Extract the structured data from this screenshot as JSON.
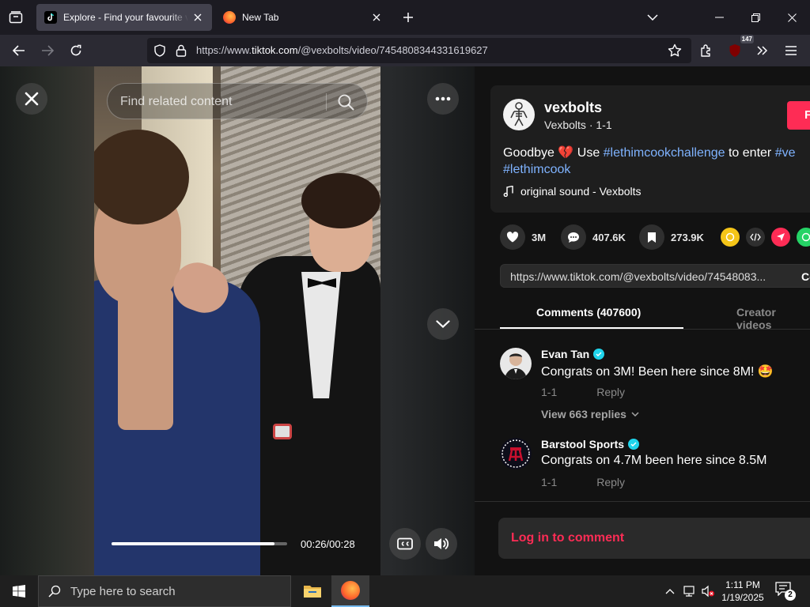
{
  "browser": {
    "tabs": [
      {
        "title": "Explore - Find your favourite vid",
        "active": true,
        "icon": "tiktok-icon"
      },
      {
        "title": "New Tab",
        "active": false,
        "icon": "firefox-icon"
      }
    ],
    "url_prefix": "https://www.",
    "url_host": "tiktok.com",
    "url_path": "/@vexbolts/video/7454808344331619627",
    "extension_badge": "147"
  },
  "video": {
    "search_placeholder": "Find related content",
    "time": "00:26/00:28",
    "progress": 0.93
  },
  "post": {
    "username": "vexbolts",
    "nickname": "Vexbolts",
    "date": "1-1",
    "follow_label": "F",
    "caption_before": "Goodbye ",
    "caption_emoji": "💔",
    "caption_use": " Use ",
    "hashtag1": "#lethimcookchallenge",
    "caption_mid": " to enter ",
    "hashtag2": "#ve",
    "hashtag3": "#lethimcook",
    "sound": "original sound - Vexbolts",
    "likes": "3M",
    "comments_count": "407.6K",
    "saves": "273.9K",
    "share_link": "https://www.tiktok.com/@vexbolts/video/74548083...",
    "copy_label": "Co"
  },
  "panel_tabs": {
    "comments": "Comments (407600)",
    "creator": "Creator videos"
  },
  "comments": [
    {
      "name": "Evan Tan",
      "text": "Congrats on 3M! Been here since 8M! 🤩",
      "date": "1-1",
      "reply": "Reply",
      "replies": "View 663 replies"
    },
    {
      "name": "Barstool Sports",
      "text": "Congrats on 4.7M been here since 8.5M",
      "date": "1-1",
      "reply": "Reply"
    }
  ],
  "login_label": "Log in to comment",
  "taskbar": {
    "search_placeholder": "Type here to search",
    "time": "1:11 PM",
    "date": "1/19/2025",
    "notifications": "2"
  },
  "colors": {
    "accent_red": "#fe2c55",
    "hashtag_blue": "#7fb3ff",
    "verified": "#20d5ec"
  }
}
